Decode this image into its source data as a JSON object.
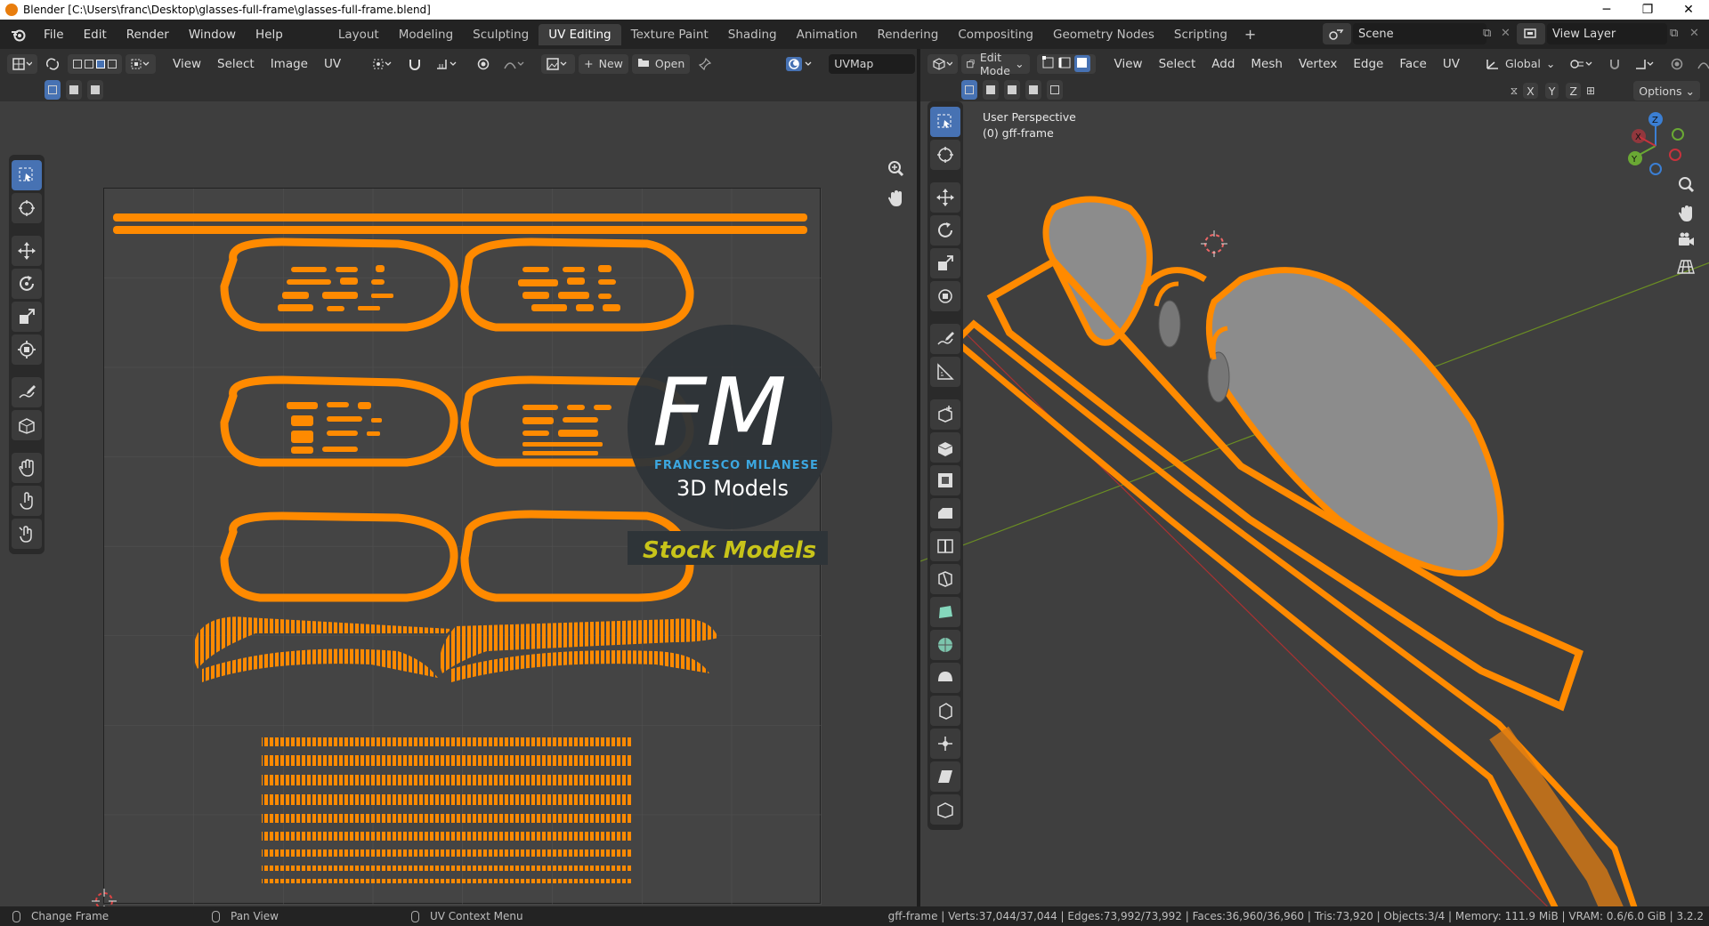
{
  "window": {
    "title": "Blender [C:\\Users\\franc\\Desktop\\glasses-full-frame\\glasses-full-frame.blend]",
    "minimize": "─",
    "restore": "❐",
    "close": "✕"
  },
  "menus": [
    "File",
    "Edit",
    "Render",
    "Window",
    "Help"
  ],
  "workspaces": [
    {
      "label": "Layout",
      "active": false
    },
    {
      "label": "Modeling",
      "active": false
    },
    {
      "label": "Sculpting",
      "active": false
    },
    {
      "label": "UV Editing",
      "active": true
    },
    {
      "label": "Texture Paint",
      "active": false
    },
    {
      "label": "Shading",
      "active": false
    },
    {
      "label": "Animation",
      "active": false
    },
    {
      "label": "Rendering",
      "active": false
    },
    {
      "label": "Compositing",
      "active": false
    },
    {
      "label": "Geometry Nodes",
      "active": false
    },
    {
      "label": "Scripting",
      "active": false
    }
  ],
  "workspace_add": "+",
  "scene": {
    "label": "Scene",
    "view_layer": "View Layer"
  },
  "uv_editor": {
    "menus": [
      "View",
      "Select",
      "Image",
      "UV"
    ],
    "new_label": "New",
    "open_label": "Open",
    "uvmap": "UVMap"
  },
  "viewport": {
    "mode": "Edit Mode",
    "menus": [
      "View",
      "Select",
      "Add",
      "Mesh",
      "Vertex",
      "Edge",
      "Face",
      "UV"
    ],
    "orientation": "Global",
    "axes": [
      "X",
      "Y",
      "Z"
    ],
    "options": "Options",
    "perspective": "User Perspective",
    "object_name": "(0) gff-frame",
    "gizmo": {
      "x": "X",
      "y": "Y",
      "z": "Z"
    }
  },
  "watermark": {
    "letters": "FM",
    "brand": "FRANCESCO MILANESE",
    "sub": "3D Models",
    "banner": "Stock Models"
  },
  "status": {
    "left": [
      {
        "label": "Change Frame"
      },
      {
        "label": "Pan View"
      },
      {
        "label": "UV Context Menu"
      }
    ],
    "stats": "gff-frame | Verts:37,044/37,044 | Edges:73,992/73,992 | Faces:36,960/36,960 | Tris:73,920 | Objects:3/4 | Memory: 111.9 MiB | VRAM: 0.6/6.0 GiB | 3.2.2"
  },
  "colors": {
    "accent": "#4772b3",
    "uv_orange": "#ff8a00",
    "stock_yellow": "#c8c41a"
  }
}
